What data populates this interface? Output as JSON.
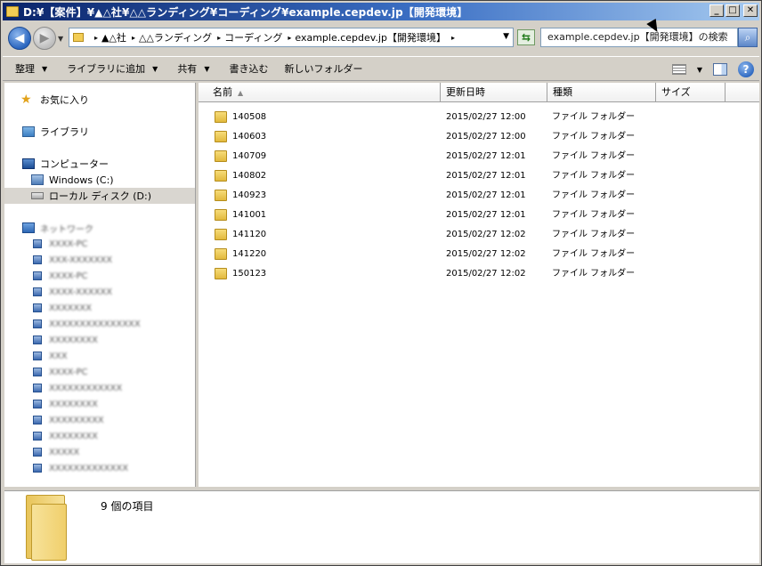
{
  "window": {
    "title": "D:¥【案件】¥▲△社¥△△ランディング¥コーディング¥example.cepdev.jp【開発環境】",
    "minimize_label": "_",
    "maximize_label": "□",
    "close_label": "✕"
  },
  "address": {
    "breadcrumbs": [
      "▲△社",
      "△△ランディング",
      "コーディング",
      "example.cepdev.jp【開発環境】"
    ],
    "search_placeholder": "example.cepdev.jp【開発環境】の検索"
  },
  "commands": {
    "organize": "整理",
    "add_to_library": "ライブラリに追加",
    "share": "共有",
    "burn": "書き込む",
    "new_folder": "新しいフォルダー"
  },
  "nav": {
    "favorites": "お気に入り",
    "libraries": "ライブラリ",
    "computer": "コンピューター",
    "drive_c": "Windows (C:)",
    "drive_d": "ローカル ディスク (D:)",
    "network": "ネットワーク",
    "network_items": [
      "XXXX-PC",
      "XXX-XXXXXXX",
      "XXXX-PC",
      "XXXX-XXXXXX",
      "XXXXXXX",
      "XXXXXXXXXXXXXXX",
      "XXXXXXXX",
      "XXX",
      "XXXX-PC",
      "XXXXXXXXXXXX",
      "XXXXXXXX",
      "XXXXXXXXX",
      "XXXXXXXX",
      "XXXXX",
      "XXXXXXXXXXXXX"
    ]
  },
  "columns": {
    "name": "名前",
    "date": "更新日時",
    "type": "種類",
    "size": "サイズ"
  },
  "files": [
    {
      "name": "140508",
      "date": "2015/02/27 12:00",
      "type": "ファイル フォルダー",
      "size": ""
    },
    {
      "name": "140603",
      "date": "2015/02/27 12:00",
      "type": "ファイル フォルダー",
      "size": ""
    },
    {
      "name": "140709",
      "date": "2015/02/27 12:01",
      "type": "ファイル フォルダー",
      "size": ""
    },
    {
      "name": "140802",
      "date": "2015/02/27 12:01",
      "type": "ファイル フォルダー",
      "size": ""
    },
    {
      "name": "140923",
      "date": "2015/02/27 12:01",
      "type": "ファイル フォルダー",
      "size": ""
    },
    {
      "name": "141001",
      "date": "2015/02/27 12:01",
      "type": "ファイル フォルダー",
      "size": ""
    },
    {
      "name": "141120",
      "date": "2015/02/27 12:02",
      "type": "ファイル フォルダー",
      "size": ""
    },
    {
      "name": "141220",
      "date": "2015/02/27 12:02",
      "type": "ファイル フォルダー",
      "size": ""
    },
    {
      "name": "150123",
      "date": "2015/02/27 12:02",
      "type": "ファイル フォルダー",
      "size": ""
    }
  ],
  "details": {
    "item_count": "9 個の項目"
  },
  "icons": [
    "folder-icon",
    "back-icon",
    "forward-icon",
    "refresh-icon",
    "search-icon",
    "view-icon",
    "preview-pane-icon",
    "help-icon",
    "star-icon",
    "library-icon",
    "computer-icon",
    "drive-icon",
    "network-icon"
  ]
}
